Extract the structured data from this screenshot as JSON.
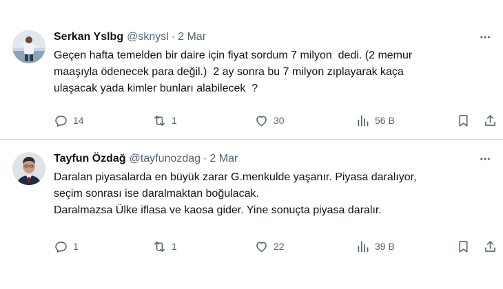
{
  "tweets": [
    {
      "author_name": "Serkan Yslbg",
      "handle": "@sknysl",
      "separator": "·",
      "date": "2 Mar",
      "text": "Geçen hafta temelden bir daire için fiyat sordum 7 milyon  dedi. (2 memur\nmaaşıyla ödenecek para değil.)  2 ay sonra bu 7 milyon zıplayarak kaça\nulaşacak yada kimler bunları alabilecek  ?",
      "replies": "14",
      "retweets": "1",
      "likes": "30",
      "views": "56 B",
      "icons": [
        "reply-icon",
        "retweet-icon",
        "heart-icon",
        "views-icon",
        "bookmark-icon",
        "share-icon",
        "more-icon"
      ]
    },
    {
      "author_name": "Tayfun Özdağ",
      "handle": "@tayfunozdag",
      "separator": "·",
      "date": "2 Mar",
      "text": "Daralan piyasalarda en büyük zarar G.menkulde yaşanır. Piyasa daralıyor,\nseçim sonrası ise daralmaktan boğulacak.\nDaralmazsa Ülke iflasa ve kaosa gider. Yine sonuçta piyasa daralır.",
      "replies": "1",
      "retweets": "1",
      "likes": "22",
      "views": "39 B",
      "icons": [
        "reply-icon",
        "retweet-icon",
        "heart-icon",
        "views-icon",
        "bookmark-icon",
        "share-icon",
        "more-icon"
      ]
    }
  ],
  "colors": {
    "text": "#0f1419",
    "secondary": "#536471",
    "divider": "#cfd9de"
  }
}
